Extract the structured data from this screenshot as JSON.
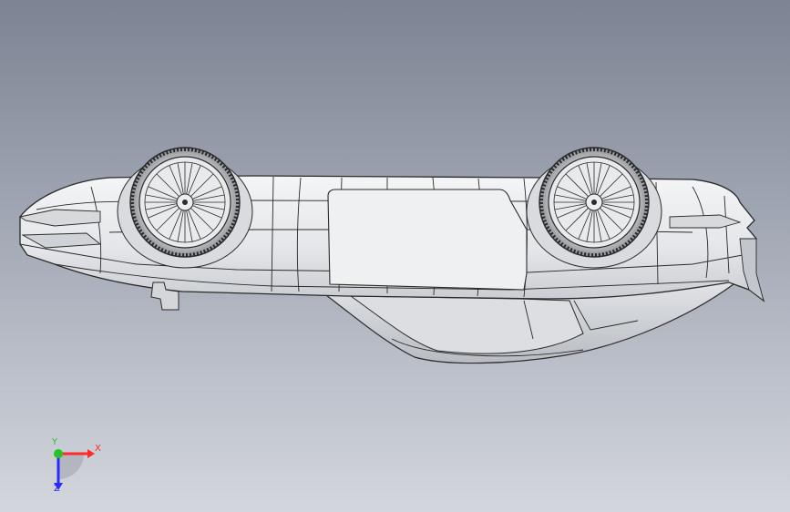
{
  "viewport": {
    "background_top": "#7d8392",
    "background_bottom": "#d3d6dc",
    "model_color": "#e9eaec",
    "edge_color": "#2a2a2a"
  },
  "model": {
    "subject": "car-body-upside-down",
    "render_style": "shaded-with-edges"
  },
  "triad": {
    "x_label": "X",
    "y_label": "Y",
    "z_label": "Z",
    "x_color": "#ff2a2a",
    "y_color": "#27c227",
    "z_color": "#2a2aff"
  }
}
